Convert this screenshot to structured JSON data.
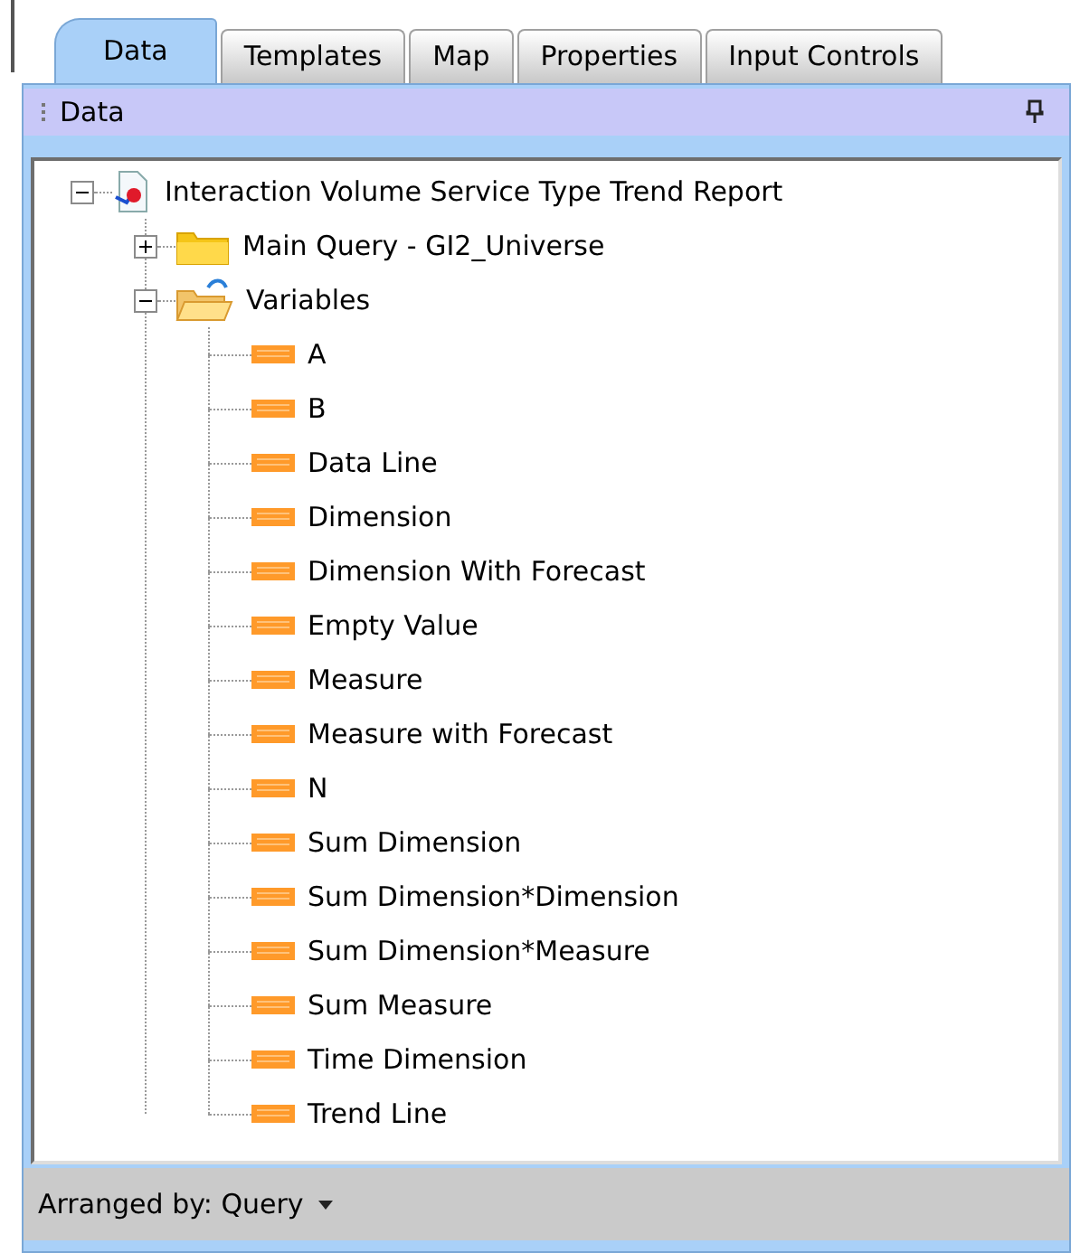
{
  "tabs": [
    {
      "label": "Data",
      "selected": true
    },
    {
      "label": "Templates",
      "selected": false
    },
    {
      "label": "Map",
      "selected": false
    },
    {
      "label": "Properties",
      "selected": false
    },
    {
      "label": "Input Controls",
      "selected": false
    }
  ],
  "panel": {
    "title": "Data"
  },
  "tree": [
    {
      "label": "Interaction Volume Service Type Trend Report",
      "kind": "report",
      "expanded": true,
      "children": [
        {
          "label": "Main Query - GI2_Universe",
          "kind": "query",
          "expanded": false
        },
        {
          "label": "Variables",
          "kind": "folder",
          "expanded": true,
          "children": [
            {
              "label": "A",
              "kind": "variable"
            },
            {
              "label": "B",
              "kind": "variable"
            },
            {
              "label": "Data Line",
              "kind": "variable"
            },
            {
              "label": "Dimension",
              "kind": "variable"
            },
            {
              "label": "Dimension With Forecast",
              "kind": "variable"
            },
            {
              "label": "Empty Value",
              "kind": "variable"
            },
            {
              "label": "Measure",
              "kind": "variable"
            },
            {
              "label": "Measure with Forecast",
              "kind": "variable"
            },
            {
              "label": "N",
              "kind": "variable"
            },
            {
              "label": "Sum Dimension",
              "kind": "variable"
            },
            {
              "label": "Sum Dimension*Dimension",
              "kind": "variable"
            },
            {
              "label": "Sum Dimension*Measure",
              "kind": "variable"
            },
            {
              "label": "Sum Measure",
              "kind": "variable"
            },
            {
              "label": "Time Dimension",
              "kind": "variable"
            },
            {
              "label": "Trend Line",
              "kind": "variable"
            }
          ]
        }
      ]
    }
  ],
  "footer": {
    "label": "Arranged by: Query"
  }
}
